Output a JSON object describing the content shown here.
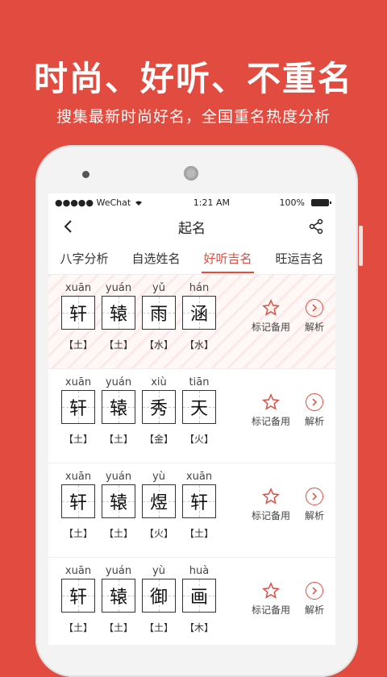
{
  "headline": "时尚、好听、不重名",
  "subline": "搜集最新时尚好名，全国重名热度分析",
  "status": {
    "carrier": "●●●●● WeChat",
    "time": "1:21 AM",
    "battery": "100%"
  },
  "navbar": {
    "title": "起名"
  },
  "tabs": [
    "八字分析",
    "自选姓名",
    "好听吉名",
    "旺运吉名"
  ],
  "active_tab": 2,
  "colors": {
    "accent": "#e24b3f"
  },
  "actions": {
    "mark_label": "标记备用",
    "analyze_label": "解析"
  },
  "rows": [
    {
      "chars": [
        {
          "py": "xuān",
          "ch": "轩",
          "el": "【土】"
        },
        {
          "py": "yuán",
          "ch": "辕",
          "el": "【土】"
        },
        {
          "py": "yǔ",
          "ch": "雨",
          "el": "【水】"
        },
        {
          "py": "hán",
          "ch": "涵",
          "el": "【水】"
        }
      ]
    },
    {
      "chars": [
        {
          "py": "xuān",
          "ch": "轩",
          "el": "【土】"
        },
        {
          "py": "yuán",
          "ch": "辕",
          "el": "【土】"
        },
        {
          "py": "xiù",
          "ch": "秀",
          "el": "【金】"
        },
        {
          "py": "tiān",
          "ch": "天",
          "el": "【火】"
        }
      ]
    },
    {
      "chars": [
        {
          "py": "xuān",
          "ch": "轩",
          "el": "【土】"
        },
        {
          "py": "yuán",
          "ch": "辕",
          "el": "【土】"
        },
        {
          "py": "yù",
          "ch": "煜",
          "el": "【火】"
        },
        {
          "py": "xuān",
          "ch": "轩",
          "el": "【土】"
        }
      ]
    },
    {
      "chars": [
        {
          "py": "xuān",
          "ch": "轩",
          "el": "【土】"
        },
        {
          "py": "yuán",
          "ch": "辕",
          "el": "【土】"
        },
        {
          "py": "yù",
          "ch": "御",
          "el": "【土】"
        },
        {
          "py": "huà",
          "ch": "画",
          "el": "【木】"
        }
      ]
    }
  ]
}
